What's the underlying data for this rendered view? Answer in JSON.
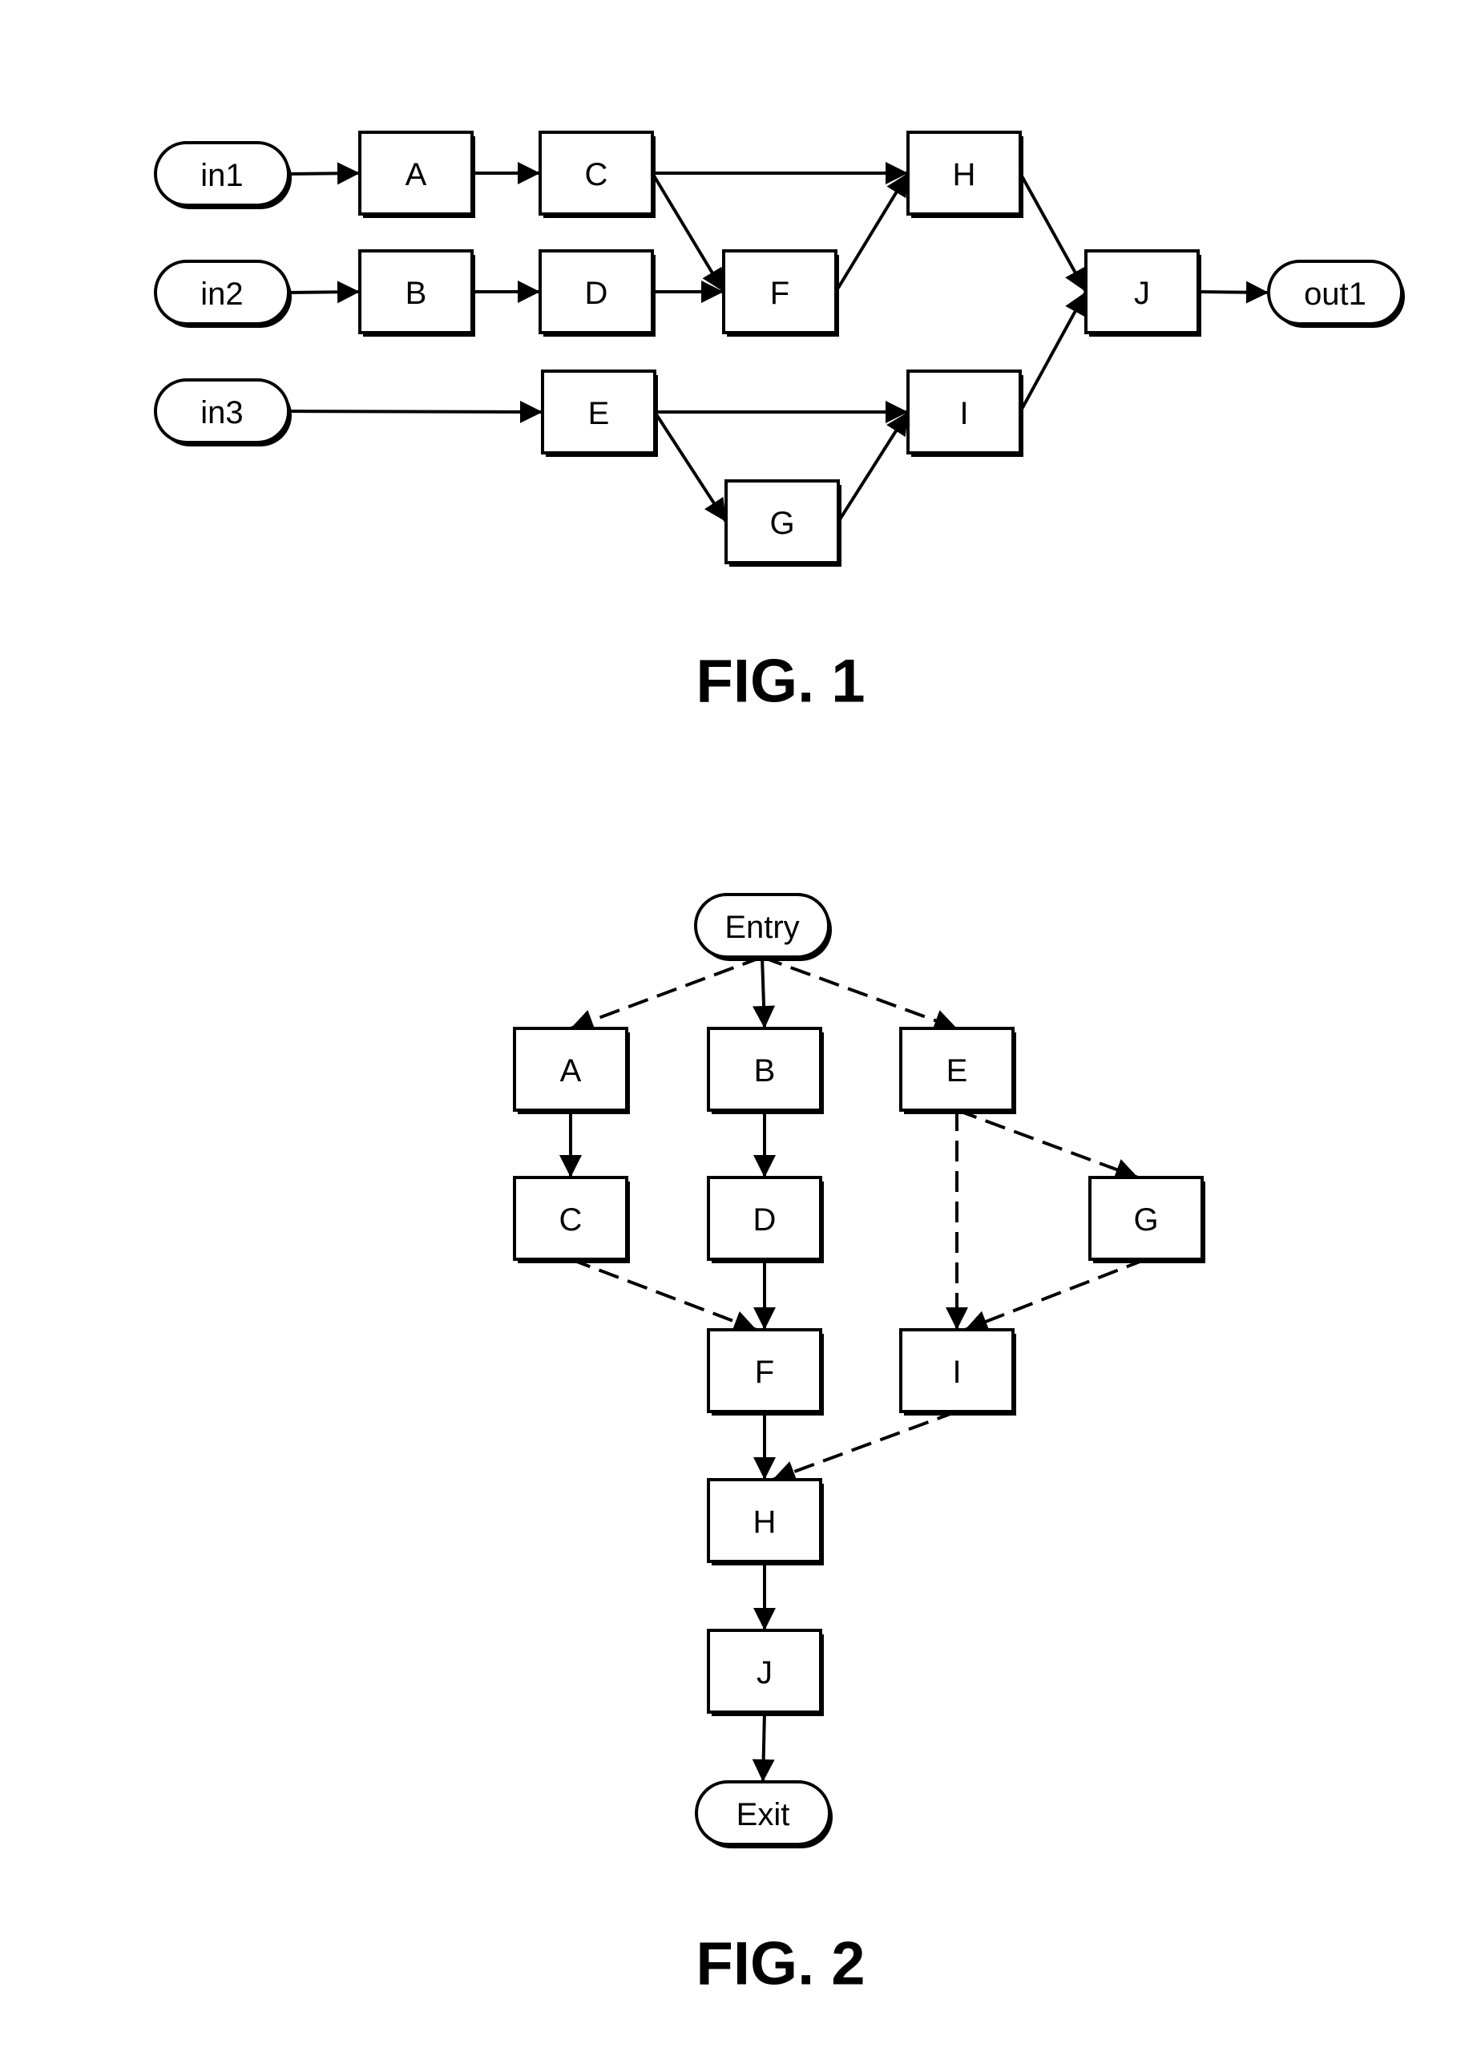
{
  "figures": [
    {
      "id": "fig1",
      "caption": "FIG. 1",
      "nodes": [
        {
          "id": "in1",
          "label": "in1",
          "shape": "terminal"
        },
        {
          "id": "in2",
          "label": "in2",
          "shape": "terminal"
        },
        {
          "id": "in3",
          "label": "in3",
          "shape": "terminal"
        },
        {
          "id": "A",
          "label": "A",
          "shape": "box"
        },
        {
          "id": "B",
          "label": "B",
          "shape": "box"
        },
        {
          "id": "C",
          "label": "C",
          "shape": "box"
        },
        {
          "id": "D",
          "label": "D",
          "shape": "box"
        },
        {
          "id": "E",
          "label": "E",
          "shape": "box"
        },
        {
          "id": "F",
          "label": "F",
          "shape": "box"
        },
        {
          "id": "G",
          "label": "G",
          "shape": "box"
        },
        {
          "id": "H",
          "label": "H",
          "shape": "box"
        },
        {
          "id": "I",
          "label": "I",
          "shape": "box"
        },
        {
          "id": "J",
          "label": "J",
          "shape": "box"
        },
        {
          "id": "out1",
          "label": "out1",
          "shape": "terminal"
        }
      ],
      "edges": [
        {
          "from": "in1",
          "to": "A",
          "style": "solid"
        },
        {
          "from": "A",
          "to": "C",
          "style": "solid"
        },
        {
          "from": "C",
          "to": "H",
          "style": "solid"
        },
        {
          "from": "C",
          "to": "F",
          "style": "solid"
        },
        {
          "from": "in2",
          "to": "B",
          "style": "solid"
        },
        {
          "from": "B",
          "to": "D",
          "style": "solid"
        },
        {
          "from": "D",
          "to": "F",
          "style": "solid"
        },
        {
          "from": "F",
          "to": "H",
          "style": "solid"
        },
        {
          "from": "H",
          "to": "J",
          "style": "solid"
        },
        {
          "from": "in3",
          "to": "E",
          "style": "solid"
        },
        {
          "from": "E",
          "to": "I",
          "style": "solid"
        },
        {
          "from": "E",
          "to": "G",
          "style": "solid"
        },
        {
          "from": "G",
          "to": "I",
          "style": "solid"
        },
        {
          "from": "I",
          "to": "J",
          "style": "solid"
        },
        {
          "from": "J",
          "to": "out1",
          "style": "solid"
        }
      ]
    },
    {
      "id": "fig2",
      "caption": "FIG. 2",
      "nodes": [
        {
          "id": "Entry",
          "label": "Entry",
          "shape": "terminal"
        },
        {
          "id": "A",
          "label": "A",
          "shape": "box"
        },
        {
          "id": "B",
          "label": "B",
          "shape": "box"
        },
        {
          "id": "E",
          "label": "E",
          "shape": "box"
        },
        {
          "id": "C",
          "label": "C",
          "shape": "box"
        },
        {
          "id": "D",
          "label": "D",
          "shape": "box"
        },
        {
          "id": "G",
          "label": "G",
          "shape": "box"
        },
        {
          "id": "F",
          "label": "F",
          "shape": "box"
        },
        {
          "id": "I",
          "label": "I",
          "shape": "box"
        },
        {
          "id": "H",
          "label": "H",
          "shape": "box"
        },
        {
          "id": "J",
          "label": "J",
          "shape": "box"
        },
        {
          "id": "Exit",
          "label": "Exit",
          "shape": "terminal"
        }
      ],
      "edges": [
        {
          "from": "Entry",
          "to": "A",
          "style": "dashed"
        },
        {
          "from": "Entry",
          "to": "B",
          "style": "solid"
        },
        {
          "from": "Entry",
          "to": "E",
          "style": "dashed"
        },
        {
          "from": "A",
          "to": "C",
          "style": "solid"
        },
        {
          "from": "B",
          "to": "D",
          "style": "solid"
        },
        {
          "from": "E",
          "to": "G",
          "style": "dashed"
        },
        {
          "from": "E",
          "to": "I",
          "style": "dashed"
        },
        {
          "from": "C",
          "to": "F",
          "style": "dashed"
        },
        {
          "from": "D",
          "to": "F",
          "style": "solid"
        },
        {
          "from": "G",
          "to": "I",
          "style": "dashed"
        },
        {
          "from": "F",
          "to": "H",
          "style": "solid"
        },
        {
          "from": "I",
          "to": "H",
          "style": "dashed"
        },
        {
          "from": "H",
          "to": "J",
          "style": "solid"
        },
        {
          "from": "J",
          "to": "Exit",
          "style": "solid"
        }
      ]
    }
  ]
}
